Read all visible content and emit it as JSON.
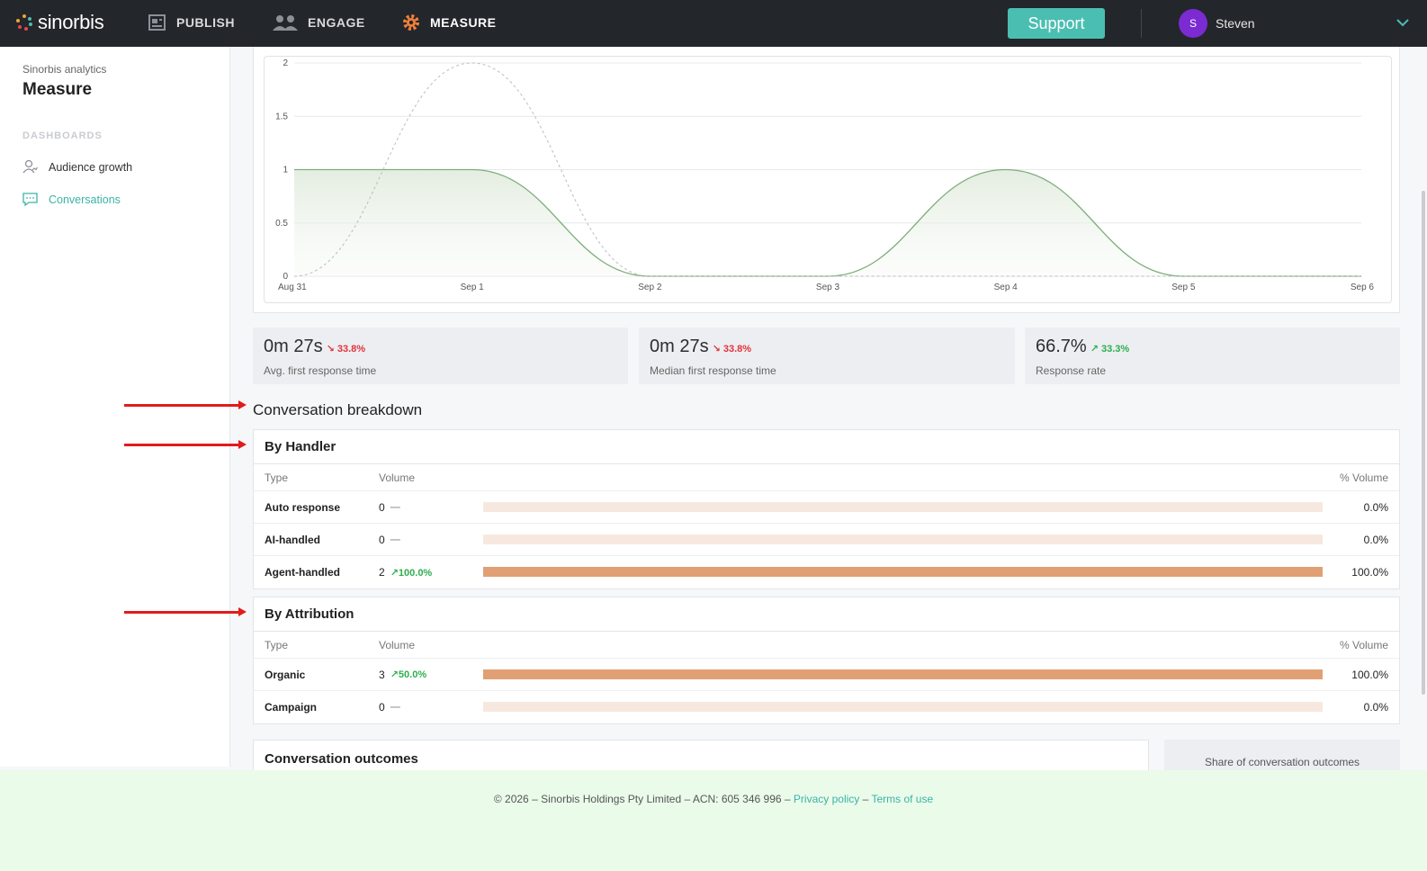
{
  "app": {
    "logo_text": "sinorbis"
  },
  "nav": {
    "items": [
      {
        "label": "PUBLISH",
        "icon": "publish-icon"
      },
      {
        "label": "ENGAGE",
        "icon": "people-icon"
      },
      {
        "label": "MEASURE",
        "icon": "gear-icon",
        "active": true
      }
    ],
    "support_label": "Support",
    "user": {
      "initial": "S",
      "name": "Steven"
    }
  },
  "sidebar": {
    "subtitle": "Sinorbis analytics",
    "title": "Measure",
    "section_label": "DASHBOARDS",
    "items": [
      {
        "label": "Audience growth",
        "icon": "audience-icon"
      },
      {
        "label": "Conversations",
        "icon": "chat-icon",
        "active": true
      }
    ]
  },
  "chart_data": {
    "type": "line",
    "x": [
      "Aug 31",
      "Sep 1",
      "Sep 2",
      "Sep 3",
      "Sep 4",
      "Sep 5",
      "Sep 6"
    ],
    "y_ticks": [
      "0",
      "0.5",
      "1",
      "1.5",
      "2"
    ],
    "ylim": [
      0,
      2
    ],
    "grid": true,
    "series": [
      {
        "values": [
          1,
          1,
          0,
          0,
          1,
          0,
          0
        ],
        "style": "solid",
        "color": "#7fae7c",
        "fill": true
      },
      {
        "values": [
          0,
          2,
          0,
          0,
          0,
          0,
          0
        ],
        "style": "dashed",
        "color": "#b9bdc2"
      }
    ]
  },
  "stats": [
    {
      "value": "0m 27s",
      "delta": "33.8%",
      "direction": "down",
      "label": "Avg. first response time"
    },
    {
      "value": "0m 27s",
      "delta": "33.8%",
      "direction": "down",
      "label": "Median first response time"
    },
    {
      "value": "66.7%",
      "delta": "33.3%",
      "direction": "up",
      "label": "Response rate"
    }
  ],
  "breakdown": {
    "title": "Conversation breakdown",
    "columns": {
      "type": "Type",
      "volume": "Volume",
      "pct": "% Volume"
    },
    "by_handler": {
      "title": "By Handler",
      "rows": [
        {
          "type": "Auto response",
          "volume": "0",
          "delta": "—",
          "trend": "flat",
          "share": 0,
          "pct": "0.0%"
        },
        {
          "type": "AI-handled",
          "volume": "0",
          "delta": "—",
          "trend": "flat",
          "share": 0,
          "pct": "0.0%"
        },
        {
          "type": "Agent-handled",
          "volume": "2",
          "delta": "100.0%",
          "trend": "up",
          "share": 1,
          "pct": "100.0%"
        }
      ]
    },
    "by_attribution": {
      "title": "By Attribution",
      "rows": [
        {
          "type": "Organic",
          "volume": "3",
          "delta": "50.0%",
          "trend": "up",
          "share": 1,
          "pct": "100.0%"
        },
        {
          "type": "Campaign",
          "volume": "0",
          "delta": "—",
          "trend": "flat",
          "share": 0,
          "pct": "0.0%"
        }
      ]
    }
  },
  "outcomes": {
    "title": "Conversation outcomes",
    "share_label": "Share of conversation outcomes"
  },
  "footer": {
    "text": "© 2026 – Sinorbis Holdings Pty Limited – ACN: 605 346 996 –",
    "privacy": "Privacy policy",
    "separator": "–",
    "terms": "Terms of use"
  }
}
